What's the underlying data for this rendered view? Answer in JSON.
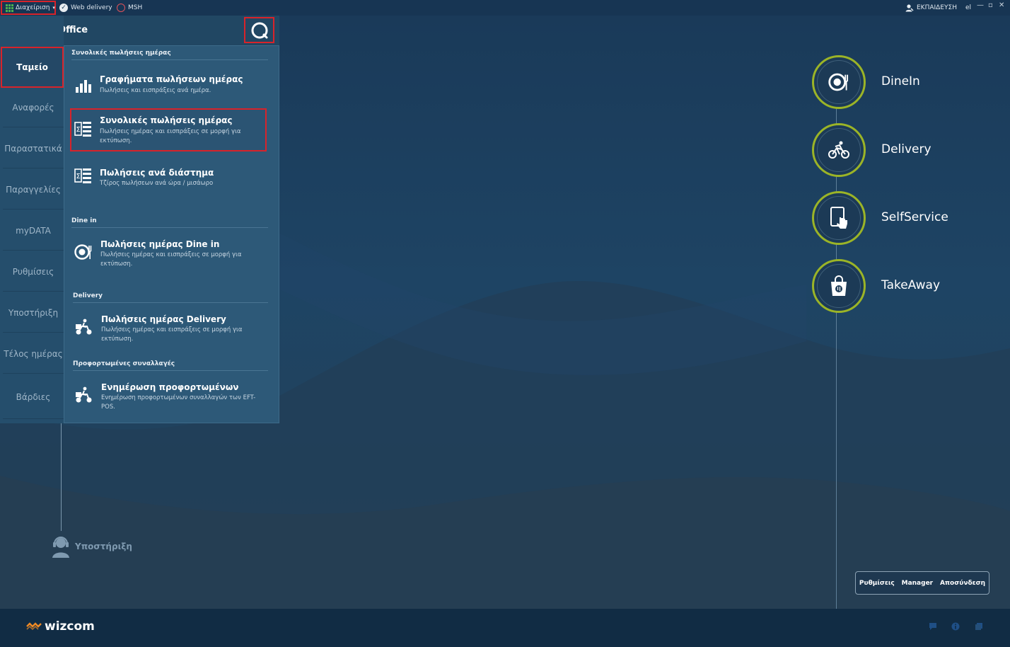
{
  "topbar": {
    "admin_label": "Διαχείριση",
    "web_delivery": "Web delivery",
    "msh": "MSH",
    "user": "ΕΚΠΑΙΔΕΥΣΗ",
    "lang": "el"
  },
  "header": {
    "title": "BackOffice"
  },
  "sidebar": {
    "items": [
      {
        "label": "Ταμείο",
        "active": true
      },
      {
        "label": "Αναφορές"
      },
      {
        "label": "Παραστατικά"
      },
      {
        "label": "Παραγγελίες"
      },
      {
        "label": "myDATA"
      },
      {
        "label": "Ρυθμίσεις"
      },
      {
        "label": "Υποστήριξη"
      },
      {
        "label": "Τέλος ημέρας"
      },
      {
        "label": "Βάρδιες"
      }
    ]
  },
  "menu": {
    "sections": [
      {
        "title": "Συνολικές πωλήσεις ημέρας",
        "items": [
          {
            "icon": "bar-chart-icon",
            "title": "Γραφήματα πωλήσεων ημέρας",
            "desc": "Πωλήσεις και εισπράξεις ανά ημέρα."
          },
          {
            "icon": "sum-list-icon",
            "title": "Συνολικές πωλήσεις ημέρας",
            "desc": "Πωλήσεις ημέρας και εισπράξεις σε μορφή για εκτύπωση.",
            "highlighted": true
          },
          {
            "icon": "sum-list-icon",
            "title": "Πωλήσεις ανά διάστημα",
            "desc": "Τζίρος πωλήσεων ανά ώρα / μισάωρο"
          }
        ]
      },
      {
        "title": "Dine in",
        "items": [
          {
            "icon": "dinein-icon",
            "title": "Πωλήσεις ημέρας Dine in",
            "desc": "Πωλήσεις ημέρας και εισπράξεις σε μορφή για εκτύπωση."
          }
        ]
      },
      {
        "title": "Delivery",
        "items": [
          {
            "icon": "scooter-icon",
            "title": "Πωλήσεις ημέρας Delivery",
            "desc": "Πωλήσεις ημέρας και εισπράξεις σε μορφή για εκτύπωση."
          }
        ]
      },
      {
        "title": "Προφορτωμένες συναλλαγές",
        "items": [
          {
            "icon": "scooter-icon",
            "title": "Ενημέρωση προφορτωμένων",
            "desc": "Ενημέρωση προφορτωμένων συναλλαγών των EFT-POS."
          }
        ]
      }
    ]
  },
  "services": [
    {
      "label": "DineIn",
      "icon": "dinein-icon"
    },
    {
      "label": "Delivery",
      "icon": "bicycle-icon"
    },
    {
      "label": "SelfService",
      "icon": "tablet-touch-icon"
    },
    {
      "label": "TakeAway",
      "icon": "shopping-bag-icon"
    }
  ],
  "support": {
    "label": "Υποστήριξη"
  },
  "actions": {
    "settings": "Ρυθμίσεις",
    "manager": "Manager",
    "logout": "Αποσύνδεση"
  },
  "footer": {
    "brand": "wizcom"
  },
  "colors": {
    "accent_green": "#9bb427",
    "highlight_red": "#d8232a",
    "panel": "#2d5978"
  }
}
